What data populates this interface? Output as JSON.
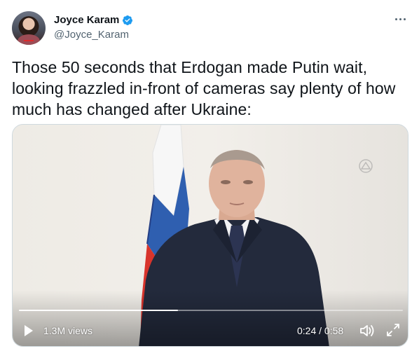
{
  "author": {
    "display_name": "Joyce Karam",
    "handle": "@Joyce_Karam",
    "verified": true
  },
  "tweet": {
    "text": "Those 50 seconds that Erdogan made Putin wait, looking frazzled in-front of cameras say plenty of how much has changed after Ukraine:"
  },
  "video": {
    "views_label": "1.3M views",
    "time_label": "0:24 / 0:58",
    "progress": 0.414,
    "icons": [
      "play-icon",
      "volume-icon",
      "fullscreen-icon"
    ]
  },
  "colors": {
    "accent": "#1d9bf0",
    "text_primary": "#0f1419",
    "text_secondary": "#536471",
    "border": "#cfd9de"
  }
}
